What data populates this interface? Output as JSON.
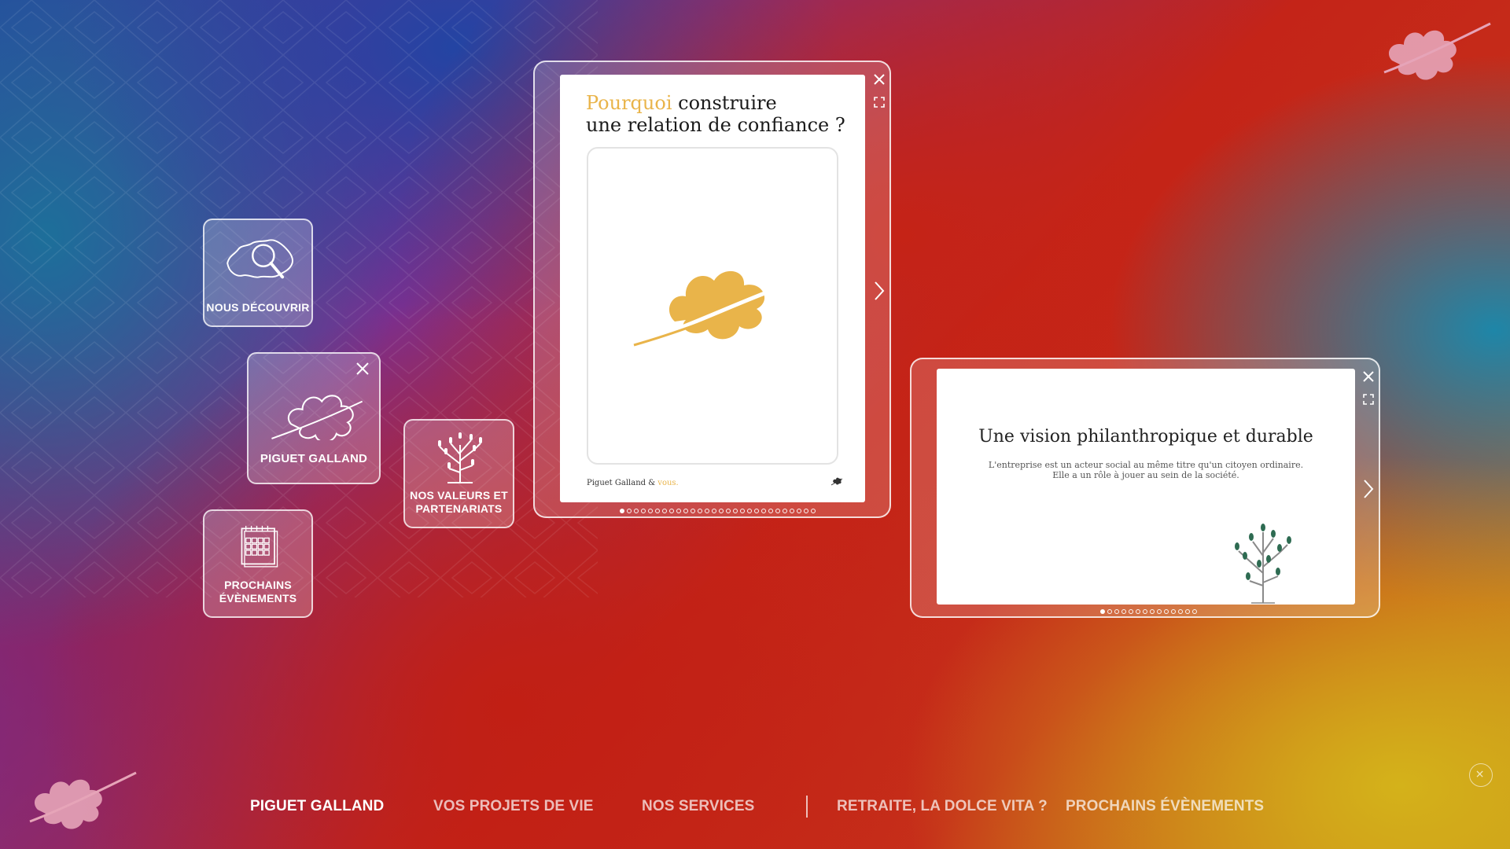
{
  "tiles": {
    "discover": {
      "label": "NOUS DÉCOUVRIR",
      "icon": "switzerland-magnifier-icon"
    },
    "piguet": {
      "label": "PIGUET GALLAND",
      "icon": "leaf-icon"
    },
    "values": {
      "label_line1": "NOS VALEURS ET",
      "label_line2": "PARTENARIATS",
      "icon": "tree-icon"
    },
    "events": {
      "label_line1": "PROCHAINS",
      "label_line2": "ÉVÈNEMENTS",
      "icon": "calendar-icon"
    }
  },
  "window_trust": {
    "title_accent": "Pourquoi",
    "title_rest1": " construire",
    "title_line2": "une relation de confiance ?",
    "footer_brand": "Piguet Galland & ",
    "footer_accent": "vous.",
    "pages_total": 28,
    "page_active": 1
  },
  "window_vision": {
    "title": "Une vision philanthropique et durable",
    "text_line1": "L'entreprise est un acteur social au même titre qu'un citoyen ordinaire.",
    "text_line2": "Elle a un rôle à jouer au sein de la société.",
    "pages_total": 14,
    "page_active": 1
  },
  "nav": {
    "items": [
      {
        "label": "PIGUET GALLAND",
        "active": true
      },
      {
        "label": "VOS PROJETS DE VIE",
        "active": false
      },
      {
        "label": "NOS SERVICES",
        "active": false
      },
      {
        "label": "RETRAITE, LA DOLCE VITA ?",
        "active": false
      },
      {
        "label": "PROCHAINS ÉVÈNEMENTS",
        "active": false
      }
    ]
  },
  "colors": {
    "accent_gold": "#e9b44a",
    "leaf_pink": "#e6a4b8",
    "tree_green": "#2e6b52"
  }
}
